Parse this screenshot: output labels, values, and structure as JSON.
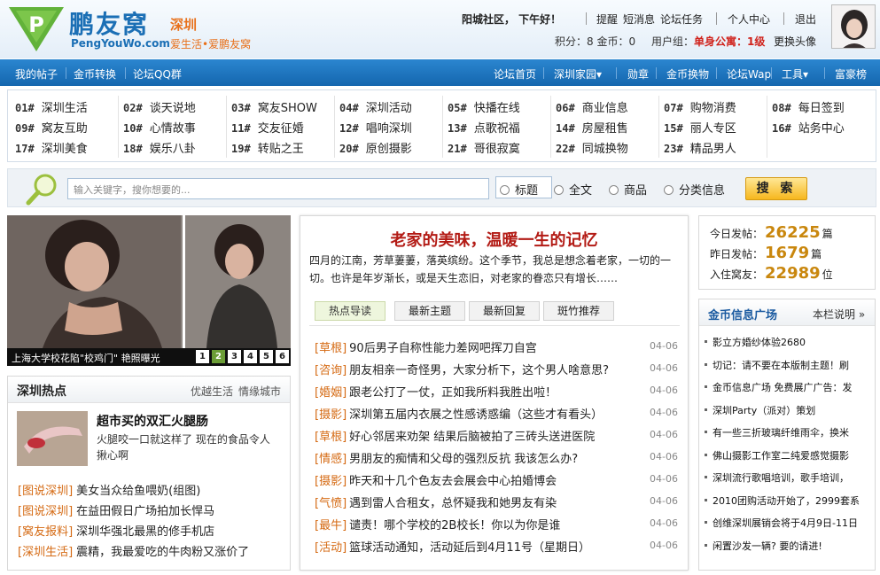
{
  "header": {
    "logo_text": "鹏友窝",
    "logo_sub": "PengYouWo.com",
    "logo_glyph": "P",
    "city": "深圳",
    "slogan": "爱生活•爱鹏友窝",
    "greeting": "阳城社区，  下午好！",
    "links": [
      "提醒",
      "短消息",
      "论坛任务",
      "个人中心",
      "退出"
    ],
    "points": "积分：8  金币：0",
    "group_label": "用户组：",
    "group_value": "单身公寓：1级",
    "change_avatar": "更换头像"
  },
  "navbar": {
    "left": [
      "我的帖子",
      "金币转换",
      "论坛QQ群"
    ],
    "right": [
      "论坛首页",
      "深圳家园▾",
      "勋章",
      "金币换物",
      "论坛Wap",
      "工具▾",
      "富豪榜"
    ]
  },
  "forums": [
    [
      {
        "n": "01#",
        "t": "深圳生活"
      },
      {
        "n": "02#",
        "t": "谈天说地"
      },
      {
        "n": "03#",
        "t": "窝友SHOW"
      },
      {
        "n": "04#",
        "t": "深圳活动"
      },
      {
        "n": "05#",
        "t": "快播在线"
      },
      {
        "n": "06#",
        "t": "商业信息"
      },
      {
        "n": "07#",
        "t": "购物消费"
      },
      {
        "n": "08#",
        "t": "每日签到"
      }
    ],
    [
      {
        "n": "09#",
        "t": "窝友互助"
      },
      {
        "n": "10#",
        "t": "心情故事"
      },
      {
        "n": "11#",
        "t": "交友征婚"
      },
      {
        "n": "12#",
        "t": "唱响深圳"
      },
      {
        "n": "13#",
        "t": "点歌祝福"
      },
      {
        "n": "14#",
        "t": "房屋租售"
      },
      {
        "n": "15#",
        "t": "丽人专区"
      },
      {
        "n": "16#",
        "t": "站务中心"
      }
    ],
    [
      {
        "n": "17#",
        "t": "深圳美食"
      },
      {
        "n": "18#",
        "t": "娱乐八卦"
      },
      {
        "n": "19#",
        "t": "转贴之王"
      },
      {
        "n": "20#",
        "t": "原创摄影"
      },
      {
        "n": "21#",
        "t": "哥很寂寞"
      },
      {
        "n": "22#",
        "t": "同城换物"
      },
      {
        "n": "23#",
        "t": "精品男人"
      }
    ]
  ],
  "search": {
    "placeholder": "输入关键字，搜你想要的...",
    "options": [
      "标题",
      "全文",
      "商品",
      "分类信息"
    ],
    "button": "搜 索"
  },
  "slideshow": {
    "caption": "上海大学校花陷\"校鸡门\" 艳照曝光",
    "pages": [
      "1",
      "2",
      "3",
      "4",
      "5",
      "6"
    ],
    "active_page": 2
  },
  "hot": {
    "title": "深圳热点",
    "tabs": [
      "优越生活",
      "情缘城市"
    ],
    "feature_title": "超市买的双汇火腿肠",
    "feature_desc": "火腿咬一口就这样了 现在的食品令人揪心啊",
    "items": [
      {
        "cat": "[图说深圳]",
        "t": "美女当众给鱼喂奶(组图)"
      },
      {
        "cat": "[图说深圳]",
        "t": "在益田假日广场拍加长悍马"
      },
      {
        "cat": "[窝友报料]",
        "t": "深圳华强北最黑的修手机店"
      },
      {
        "cat": "[深圳生活]",
        "t": "震精，我最爱吃的牛肉粉又涨价了"
      }
    ]
  },
  "center": {
    "headline": "老家的美味，温暖一生的记忆",
    "desc": "四月的江南，芳草萋萋，落英缤纷。这个季节，我总是想念着老家，一切的一切。也许是年岁渐长，或是天生恋旧，对老家的眷恋只有增长……",
    "tabs": [
      "热点导读",
      "最新主题",
      "最新回复",
      "斑竹推荐"
    ],
    "items": [
      {
        "cat": "[草根]",
        "t": "90后男子自称性能力差网吧挥刀自宫",
        "d": "04-06"
      },
      {
        "cat": "[咨询]",
        "t": "朋友相亲一奇怪男，大家分析下，这个男人啥意思?",
        "d": "04-06"
      },
      {
        "cat": "[婚姻]",
        "t": "跟老公打了一仗，正如我所料我胜出啦！",
        "d": "04-06"
      },
      {
        "cat": "[摄影]",
        "t": "深圳第五届内衣展之性感诱惑编（这些才有看头）",
        "d": "04-06"
      },
      {
        "cat": "[草根]",
        "t": "好心邻居来劝架 结果后脑被拍了三砖头送进医院",
        "d": "04-06"
      },
      {
        "cat": "[情感]",
        "t": "男朋友的痴情和父母的强烈反抗 我该怎么办?",
        "d": "04-06"
      },
      {
        "cat": "[摄影]",
        "t": "昨天和十几个色友去会展会中心拍婚博会",
        "d": "04-06"
      },
      {
        "cat": "[气愤]",
        "t": "遇到雷人合租女，总怀疑我和她男友有染",
        "d": "04-06"
      },
      {
        "cat": "[最牛]",
        "t": "谴责！哪个学校的2B校长！你以为你是谁",
        "d": "04-06"
      },
      {
        "cat": "[活动]",
        "t": "篮球活动通知，活动延后到4月11号（星期日）",
        "d": "04-06"
      }
    ]
  },
  "stats": [
    {
      "label": "今日发帖：",
      "value": "26225",
      "unit": "篇"
    },
    {
      "label": "昨日发帖：",
      "value": "1679",
      "unit": "篇"
    },
    {
      "label": "入住窝友：",
      "value": "22989",
      "unit": "位"
    }
  ],
  "coin": {
    "title": "金币信息广场",
    "more": "本栏说明 »",
    "items": [
      "影立方婚纱体验2680",
      "切记：请不要在本版制主题！刷",
      "金币信息广场 免费展广广告：发",
      "深圳Party（派对）策划",
      "有一些三折玻璃纤维雨伞，换米",
      "佛山摄影工作室二纯爱感觉摄影",
      "深圳流行歌唱培训，歌手培训，",
      "2010团购活动开始了，2999套系",
      "创维深圳展销会将于4月9日-11日",
      "闲置沙发一辆? 要的请进!"
    ]
  },
  "colors": {
    "brand_blue": "#1b6fb5",
    "nav_blue": "#1466ae",
    "orange": "#e8701a",
    "red": "#b31b15",
    "gold": "#c9870e"
  }
}
